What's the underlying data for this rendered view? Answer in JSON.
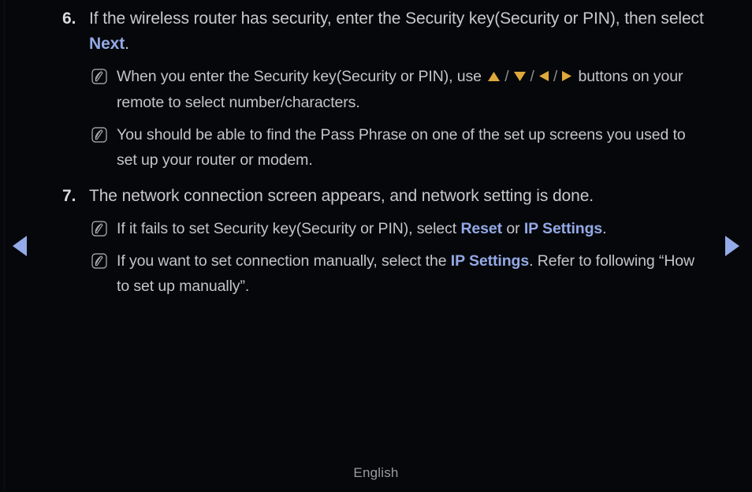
{
  "theme": {
    "background": "#06070a",
    "body_text": "#c9c9cc",
    "highlight_blue": "#93a9e6",
    "arrow_gold": "#dfa83c",
    "nav_blue": "#93abe8",
    "footer_text": "#9b9b9e"
  },
  "nav": {
    "prev_label": "previous-page",
    "next_label": "next-page",
    "prev_icon": "triangle-left-icon",
    "next_icon": "triangle-right-icon"
  },
  "steps": [
    {
      "number": "6.",
      "text_before_link": "If the wireless router has security, enter the Security key(Security or PIN), then select ",
      "link": "Next",
      "text_after_link": "."
    },
    {
      "number": "7.",
      "text": "The network connection screen appears, and network setting is done."
    }
  ],
  "notes": [
    {
      "icon": "note-pen-icon",
      "part1": "When you enter the Security key(Security or PIN), use ",
      "arrows": [
        "triangle-up-icon",
        "triangle-down-icon",
        "triangle-left-icon",
        "triangle-right-icon"
      ],
      "separator": "/",
      "part2": " buttons on your remote to select number/characters."
    },
    {
      "icon": "note-pen-icon",
      "text": "You should be able to find the Pass Phrase on one of the set up screens you used to set up your router or modem."
    },
    {
      "icon": "note-pen-icon",
      "part1": "If it fails to set Security key(Security or PIN), select ",
      "link1": "Reset",
      "part2": " or ",
      "link2": "IP Settings",
      "part3": "."
    },
    {
      "icon": "note-pen-icon",
      "part1": "If you want to set connection manually, select the ",
      "link1": "IP Settings",
      "part2": ". Refer to following “How to set up manually”."
    }
  ],
  "footer": {
    "language": "English"
  }
}
